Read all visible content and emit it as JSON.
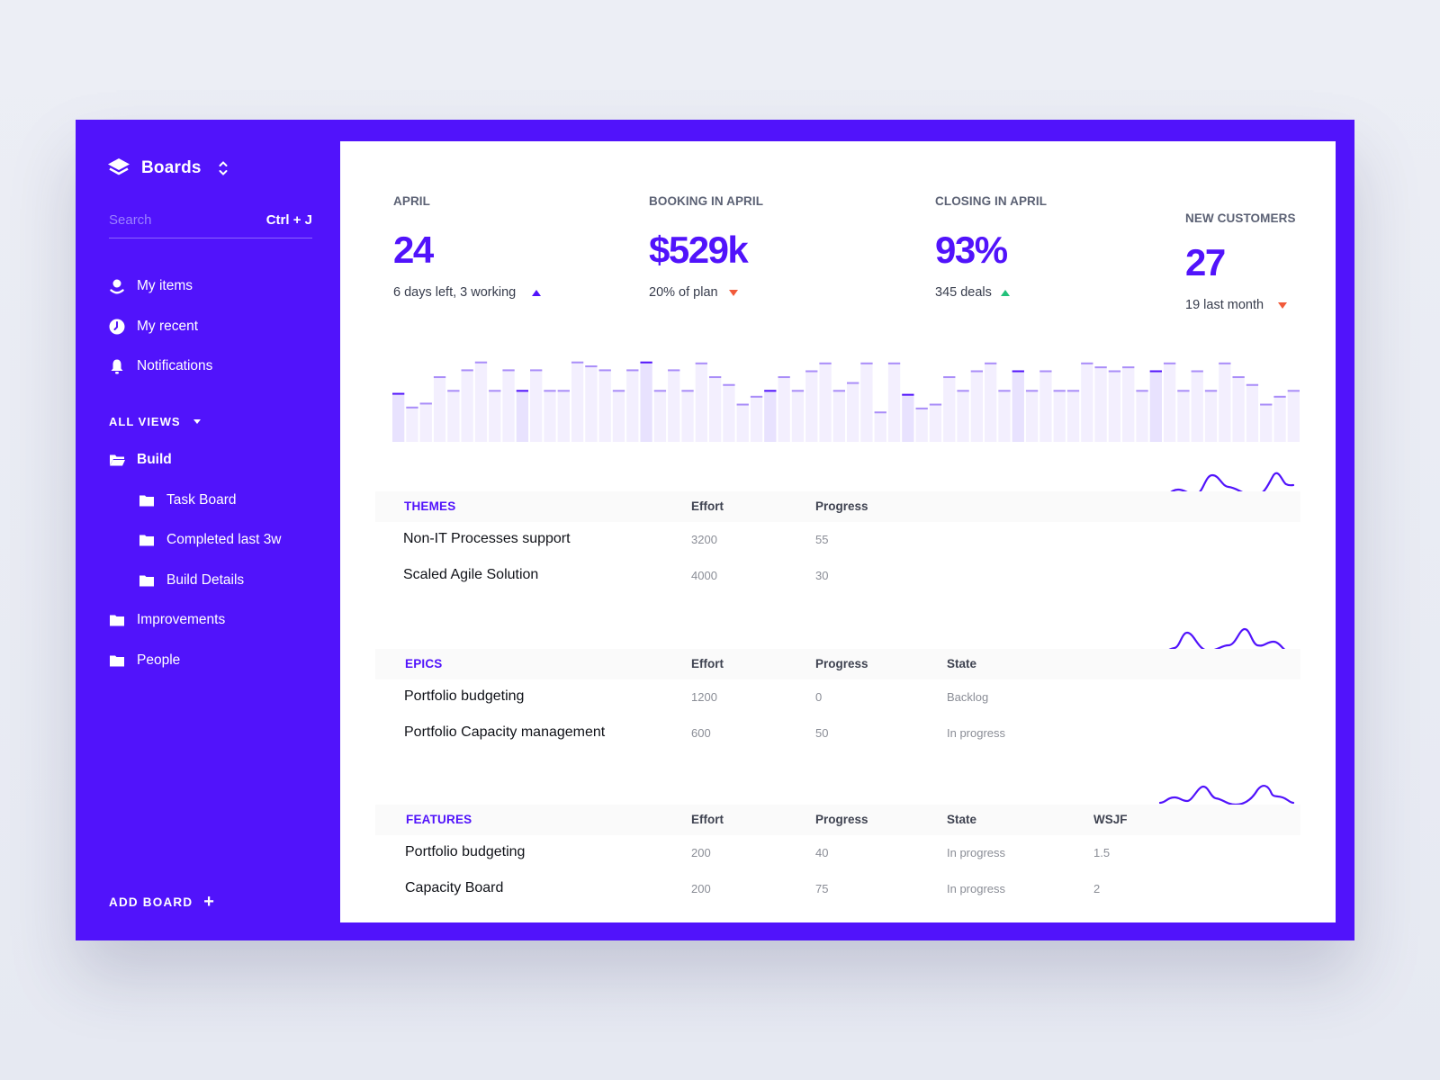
{
  "colors": {
    "brand": "#5113fb",
    "up_brand": "#5113fb",
    "up_green": "#22c17a",
    "down_red": "#f15a3a",
    "bar_light": "#f3effe",
    "bar_mid": "#e8e2fe",
    "cap_light": "#a98df8",
    "cap_dark": "#5113fb"
  },
  "sidebar": {
    "title": "Boards",
    "logo_icon": "layers-icon",
    "switch_icon": "chevron-up-down-icon",
    "search": {
      "placeholder": "Search",
      "value": "",
      "shortcut": "Ctrl + J"
    },
    "quick_items": [
      {
        "label": "My items",
        "icon": "user-icon"
      },
      {
        "label": "My recent",
        "icon": "clock-icon"
      },
      {
        "label": "Notifications",
        "icon": "bell-icon"
      }
    ],
    "views_label": "ALL VIEWS",
    "views": [
      {
        "label": "Build",
        "icon": "folder-open-icon",
        "active": true,
        "children": [
          {
            "label": "Task Board",
            "icon": "folder-icon"
          },
          {
            "label": "Completed last 3w",
            "icon": "folder-icon"
          },
          {
            "label": "Build Details",
            "icon": "folder-icon"
          }
        ]
      },
      {
        "label": "Improvements",
        "icon": "folder-icon"
      },
      {
        "label": "People",
        "icon": "folder-icon"
      }
    ],
    "add_board": "ADD BOARD"
  },
  "kpis": [
    {
      "label": "APRIL",
      "value": "24",
      "sub": "6 days left, 3 working",
      "trend": "up",
      "trend_color": "#5113fb"
    },
    {
      "label": "BOOKING IN APRIL",
      "value": "$529k",
      "sub": "20% of plan",
      "trend": "down",
      "trend_color": "#f15a3a"
    },
    {
      "label": "CLOSING IN APRIL",
      "value": "93%",
      "sub": "345 deals",
      "trend": "up",
      "trend_color": "#22c17a"
    },
    {
      "label": "NEW CUSTOMERS",
      "value": "27",
      "sub": "19 last month",
      "trend": "down",
      "trend_color": "#f15a3a"
    }
  ],
  "chart_data": {
    "type": "bar",
    "title": "",
    "xlabel": "",
    "ylabel": "",
    "ylim": [
      0,
      90
    ],
    "grid": false,
    "values": [
      50,
      36,
      40,
      67,
      53,
      74,
      82,
      53,
      74,
      53,
      74,
      53,
      53,
      82,
      78,
      74,
      53,
      74,
      82,
      53,
      74,
      53,
      81,
      67,
      59,
      39,
      47,
      53,
      67,
      53,
      73,
      81,
      53,
      61,
      81,
      31,
      81,
      49,
      35,
      39,
      67,
      53,
      73,
      81,
      53,
      73,
      53,
      73,
      53,
      53,
      81,
      77,
      73,
      77,
      53,
      73,
      81,
      53,
      73,
      53,
      81,
      67,
      59,
      39,
      47,
      53
    ],
    "highlighted": [
      0,
      9,
      18,
      27,
      37,
      45,
      55
    ]
  },
  "tables": [
    {
      "group": "THEMES",
      "columns": [
        "Effort",
        "Progress"
      ],
      "rows": [
        {
          "name": "Non-IT Processes support",
          "cells": [
            "3200",
            "55"
          ]
        },
        {
          "name": "Scaled Agile Solution",
          "cells": [
            "4000",
            "30"
          ]
        }
      ]
    },
    {
      "group": "EPICS",
      "columns": [
        "Effort",
        "Progress",
        "State"
      ],
      "rows": [
        {
          "name": "Portfolio budgeting",
          "cells": [
            "1200",
            "0",
            "Backlog"
          ]
        },
        {
          "name": "Portfolio Capacity management",
          "cells": [
            "600",
            "50",
            "In progress"
          ]
        }
      ]
    },
    {
      "group": "FEATURES",
      "columns": [
        "Effort",
        "Progress",
        "State",
        "WSJF"
      ],
      "rows": [
        {
          "name": "Portfolio budgeting",
          "cells": [
            "200",
            "40",
            "In progress",
            "1.5"
          ]
        },
        {
          "name": "Capacity Board",
          "cells": [
            "200",
            "75",
            "In progress",
            "2"
          ]
        }
      ]
    }
  ]
}
